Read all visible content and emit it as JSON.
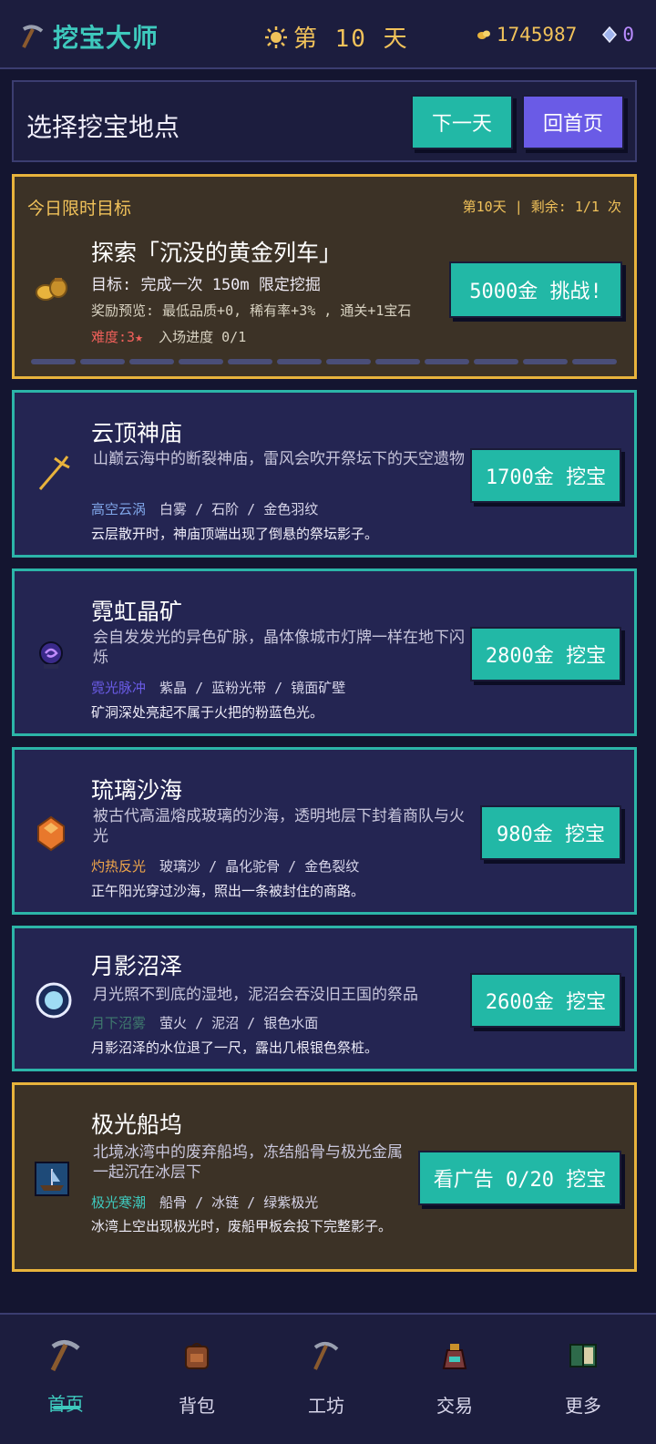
{
  "top": {
    "app_title": "挖宝大师",
    "day": "第 10 天",
    "gold": "1745987",
    "gems": "0"
  },
  "header": {
    "title": "选择挖宝地点",
    "next_day": "下一天",
    "home": "回首页"
  },
  "goal": {
    "heading": "今日限时目标",
    "meta": "第10天 | 剩余: 1/1 次",
    "title": "探索「沉没的黄金列车」",
    "target": "目标: 完成一次 150m 限定挖掘",
    "reward": "奖励预览: 最低品质+0, 稀有率+3% , 通关+1宝石",
    "difficulty_label": "难度:3★",
    "progress_text": "入场进度 0/1",
    "button": "5000金 挑战!",
    "progress_current": 0,
    "progress_total": 1
  },
  "sites": [
    {
      "title": "云顶神庙",
      "desc": "山巅云海中的断裂神庙，雷风会吹开祭坛下的天空遗物",
      "tag_main": "高空云涡",
      "tags": "白雾 / 石阶 / 金色羽纹",
      "hint": "云层散开时，神庙顶端出现了倒悬的祭坛影子。",
      "button": "1700金 挖宝",
      "icon": "trident-icon",
      "tag_color": "#7fa5e8"
    },
    {
      "title": "霓虹晶矿",
      "desc": "会自发发光的异色矿脉，晶体像城市灯牌一样在地下闪烁",
      "tag_main": "霓光脉冲",
      "tags": "紫晶 / 蓝粉光带 / 镜面矿壁",
      "hint": "矿洞深处亮起不属于火把的粉蓝色光。",
      "button": "2800金 挖宝",
      "icon": "purple-orb-icon",
      "tag_color": "#6a5be6"
    },
    {
      "title": "琉璃沙海",
      "desc": "被古代高温熔成玻璃的沙海，透明地层下封着商队与火光",
      "tag_main": "灼热反光",
      "tags": "玻璃沙 / 晶化驼骨 / 金色裂纹",
      "hint": "正午阳光穿过沙海，照出一条被封住的商路。",
      "button": "980金 挖宝",
      "icon": "amber-gem-icon",
      "tag_color": "#f0a64a"
    },
    {
      "title": "月影沼泽",
      "desc": "月光照不到底的湿地，泥沼会吞没旧王国的祭品",
      "tag_main": "月下沼雾",
      "tags": "萤火 / 泥沼 / 银色水面",
      "hint": "月影沼泽的水位退了一尺，露出几根银色祭桩。",
      "button": "2600金 挖宝",
      "icon": "moon-ring-icon",
      "tag_color": "#3f7a6e"
    },
    {
      "title": "极光船坞",
      "desc": "北境冰湾中的废弃船坞，冻结船骨与极光金属一起沉在冰层下",
      "tag_main": "极光寒潮",
      "tags": "船骨 / 冰链 / 绿紫极光",
      "hint": "冰湾上空出现极光时，废船甲板会投下完整影子。",
      "button": "看广告 0/20 挖宝",
      "icon": "ship-picture-icon",
      "tag_color": "#3ec9bd"
    }
  ],
  "nav": [
    {
      "label": "首页",
      "icon": "pickaxe-icon"
    },
    {
      "label": "背包",
      "icon": "backpack-icon"
    },
    {
      "label": "工坊",
      "icon": "pickaxe-icon"
    },
    {
      "label": "交易",
      "icon": "trade-bag-icon"
    },
    {
      "label": "更多",
      "icon": "book-icon"
    }
  ],
  "colors": {
    "accent_teal": "#22b8a6",
    "accent_purple": "#6a5be6",
    "gold": "#f1c25a",
    "bg": "#141530"
  }
}
